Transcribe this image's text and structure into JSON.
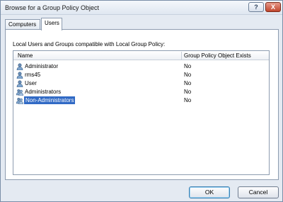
{
  "window": {
    "title": "Browse for a Group Policy Object",
    "help_label": "?",
    "close_label": "X"
  },
  "tabs": [
    {
      "label": "Computers",
      "active": false
    },
    {
      "label": "Users",
      "active": true
    }
  ],
  "panel": {
    "caption": "Local Users and Groups compatible with Local Group Policy:",
    "columns": [
      "Name",
      "Group Policy Object Exists"
    ],
    "rows": [
      {
        "icon": "user-icon",
        "name": "Administrator",
        "exists": "No",
        "selected": false
      },
      {
        "icon": "user-icon",
        "name": "rms45",
        "exists": "No",
        "selected": false
      },
      {
        "icon": "user-icon",
        "name": "User",
        "exists": "No",
        "selected": false
      },
      {
        "icon": "group-icon",
        "name": "Administrators",
        "exists": "No",
        "selected": false
      },
      {
        "icon": "group-icon",
        "name": "Non-Administrators",
        "exists": "No",
        "selected": true
      }
    ]
  },
  "buttons": {
    "ok_label": "OK",
    "cancel_label": "Cancel"
  },
  "colors": {
    "selection": "#316ac5",
    "window_bg": "#e4eaf2",
    "border": "#8d9cb0"
  }
}
